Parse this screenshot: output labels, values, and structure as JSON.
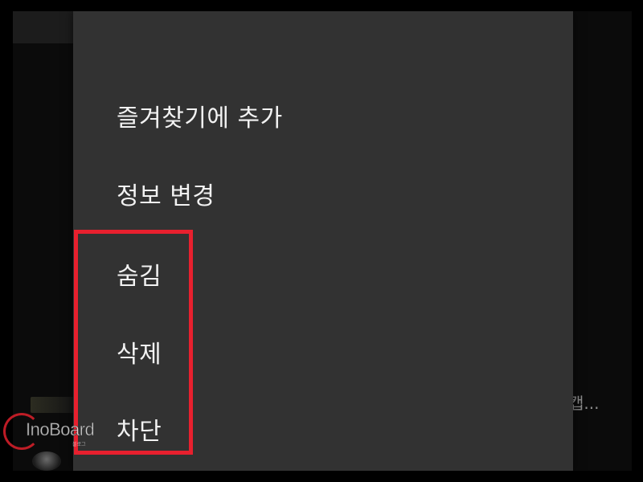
{
  "menu": {
    "items": [
      {
        "label": "즐겨찾기에 추가"
      },
      {
        "label": "정보 변경"
      },
      {
        "label": "숨김"
      },
      {
        "label": "삭제"
      },
      {
        "label": "차단"
      }
    ]
  },
  "background": {
    "truncated_text": "캡..."
  },
  "watermark": {
    "text": "InoBoard",
    "subtext": "블로그"
  },
  "colors": {
    "panel": "#323232",
    "highlight": "#e8202e",
    "text": "#f2f2f2"
  }
}
